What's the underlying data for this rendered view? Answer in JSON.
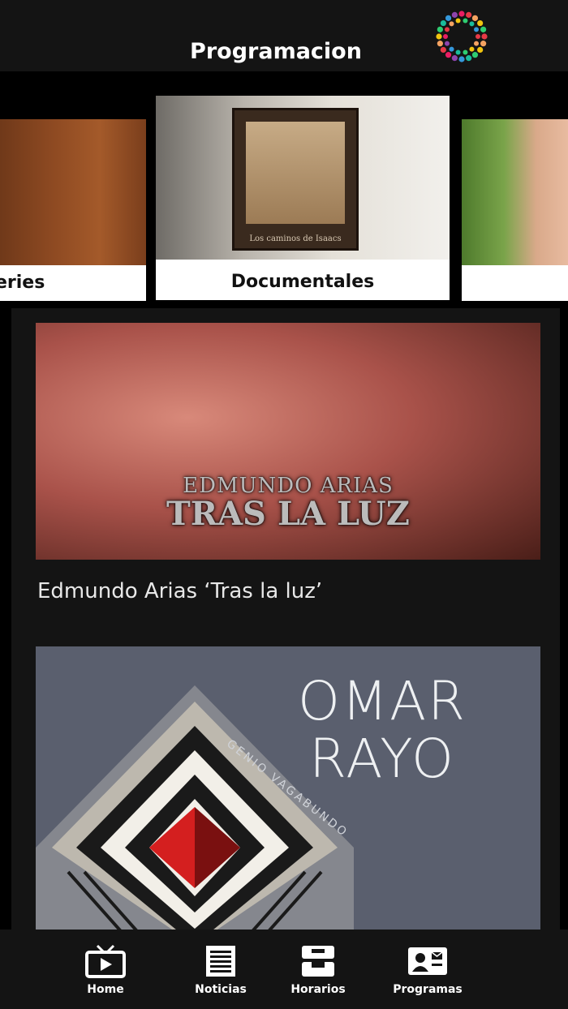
{
  "header": {
    "title": "Programacion",
    "logo_icon": "colorful-dot-ring-logo"
  },
  "carousel": {
    "cards": [
      {
        "label": "eries"
      },
      {
        "label": "Documentales"
      },
      {
        "label": ""
      }
    ],
    "frame_caption": "Los caminos de Isaacs"
  },
  "feed": {
    "items": [
      {
        "overlay_line1": "EDMUNDO ARIAS",
        "overlay_line2": "TRAS LA LUZ",
        "title": "Edmundo Arias ‘Tras la luz’"
      },
      {
        "poster_line1": "OMAR",
        "poster_line2": "RAYO",
        "poster_sub": "GENIO VAGABUNDO"
      }
    ]
  },
  "bottom_nav": {
    "items": [
      {
        "label": "Home",
        "icon": "tv-play-icon"
      },
      {
        "label": "Noticias",
        "icon": "news-icon"
      },
      {
        "label": "Horarios",
        "icon": "schedule-tray-icon"
      },
      {
        "label": "Programas",
        "icon": "profile-card-icon"
      }
    ]
  },
  "colors": {
    "bar": "#141414",
    "background": "#000000",
    "text": "#ffffff"
  }
}
